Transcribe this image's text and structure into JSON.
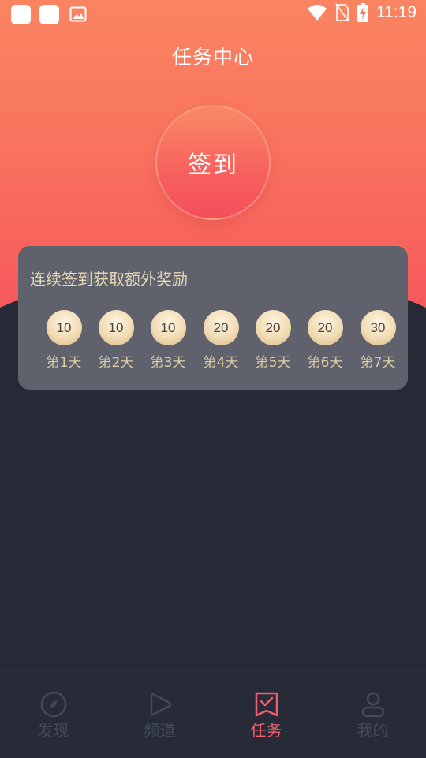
{
  "status_bar": {
    "time": "11:19"
  },
  "header": {
    "title": "任务中心"
  },
  "sign_in": {
    "label": "签到"
  },
  "reward_card": {
    "title": "连续签到获取额外奖励",
    "days": [
      {
        "value": "10",
        "label": "第1天"
      },
      {
        "value": "10",
        "label": "第2天"
      },
      {
        "value": "10",
        "label": "第3天"
      },
      {
        "value": "20",
        "label": "第4天"
      },
      {
        "value": "20",
        "label": "第5天"
      },
      {
        "value": "20",
        "label": "第6天"
      },
      {
        "value": "30",
        "label": "第7天"
      }
    ]
  },
  "bottom_nav": {
    "items": [
      {
        "label": "发现",
        "icon": "compass-icon",
        "active": false
      },
      {
        "label": "频道",
        "icon": "play-icon",
        "active": false
      },
      {
        "label": "任务",
        "icon": "task-icon",
        "active": true
      },
      {
        "label": "我的",
        "icon": "user-icon",
        "active": false
      }
    ]
  },
  "colors": {
    "accent": "#f25f6c",
    "hero_top": "#fa8461",
    "hero_bottom": "#f6585c",
    "background": "#262a37",
    "card": "#5f626d",
    "gold_text": "#e6d8b4"
  }
}
